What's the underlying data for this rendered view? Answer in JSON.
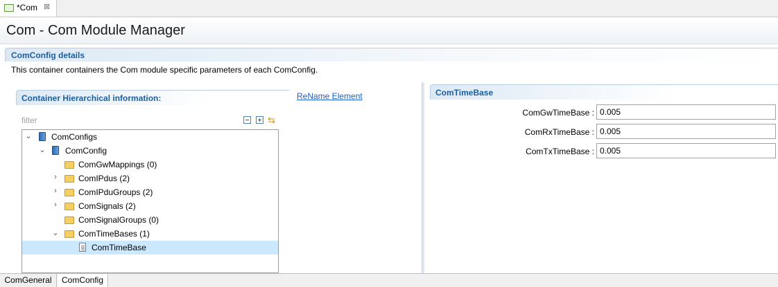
{
  "editor_tab": {
    "label": "*Com",
    "close": "⊠"
  },
  "title": "Com - Com Module Manager",
  "section": {
    "title": "ComConfig details",
    "description": "This container containers the Com module specific parameters of each ComConfig."
  },
  "hierarchy": {
    "title": "Container Hierarchical information:",
    "rename_link": "ReName Element",
    "filter_placeholder": "filter",
    "tree": [
      {
        "label": "ComConfigs",
        "icon": "database-icon",
        "expanded": true
      },
      {
        "label": "ComConfig",
        "icon": "database-icon",
        "expanded": true
      },
      {
        "label": "ComGwMappings (0)",
        "icon": "folder-icon"
      },
      {
        "label": "ComIPdus (2)",
        "icon": "folder-icon",
        "expanded": false
      },
      {
        "label": "ComIPduGroups (2)",
        "icon": "folder-icon",
        "expanded": false
      },
      {
        "label": "ComSignals (2)",
        "icon": "folder-icon",
        "expanded": false
      },
      {
        "label": "ComSignalGroups (0)",
        "icon": "folder-icon"
      },
      {
        "label": "ComTimeBases (1)",
        "icon": "folder-icon",
        "expanded": true
      },
      {
        "label": "ComTimeBase",
        "icon": "document-icon",
        "selected": true
      }
    ]
  },
  "details": {
    "title": "ComTimeBase",
    "fields": [
      {
        "label": "ComGwTimeBase :",
        "value": "0.005"
      },
      {
        "label": "ComRxTimeBase :",
        "value": "0.005"
      },
      {
        "label": "ComTxTimeBase :",
        "value": "0.005"
      }
    ]
  },
  "page_tabs": [
    {
      "label": "ComGeneral",
      "active": false
    },
    {
      "label": "ComConfig",
      "active": true
    }
  ],
  "colors": {
    "section_title": "#1a5e9e",
    "link": "#1a5ec8",
    "selection": "#cce8ff"
  }
}
